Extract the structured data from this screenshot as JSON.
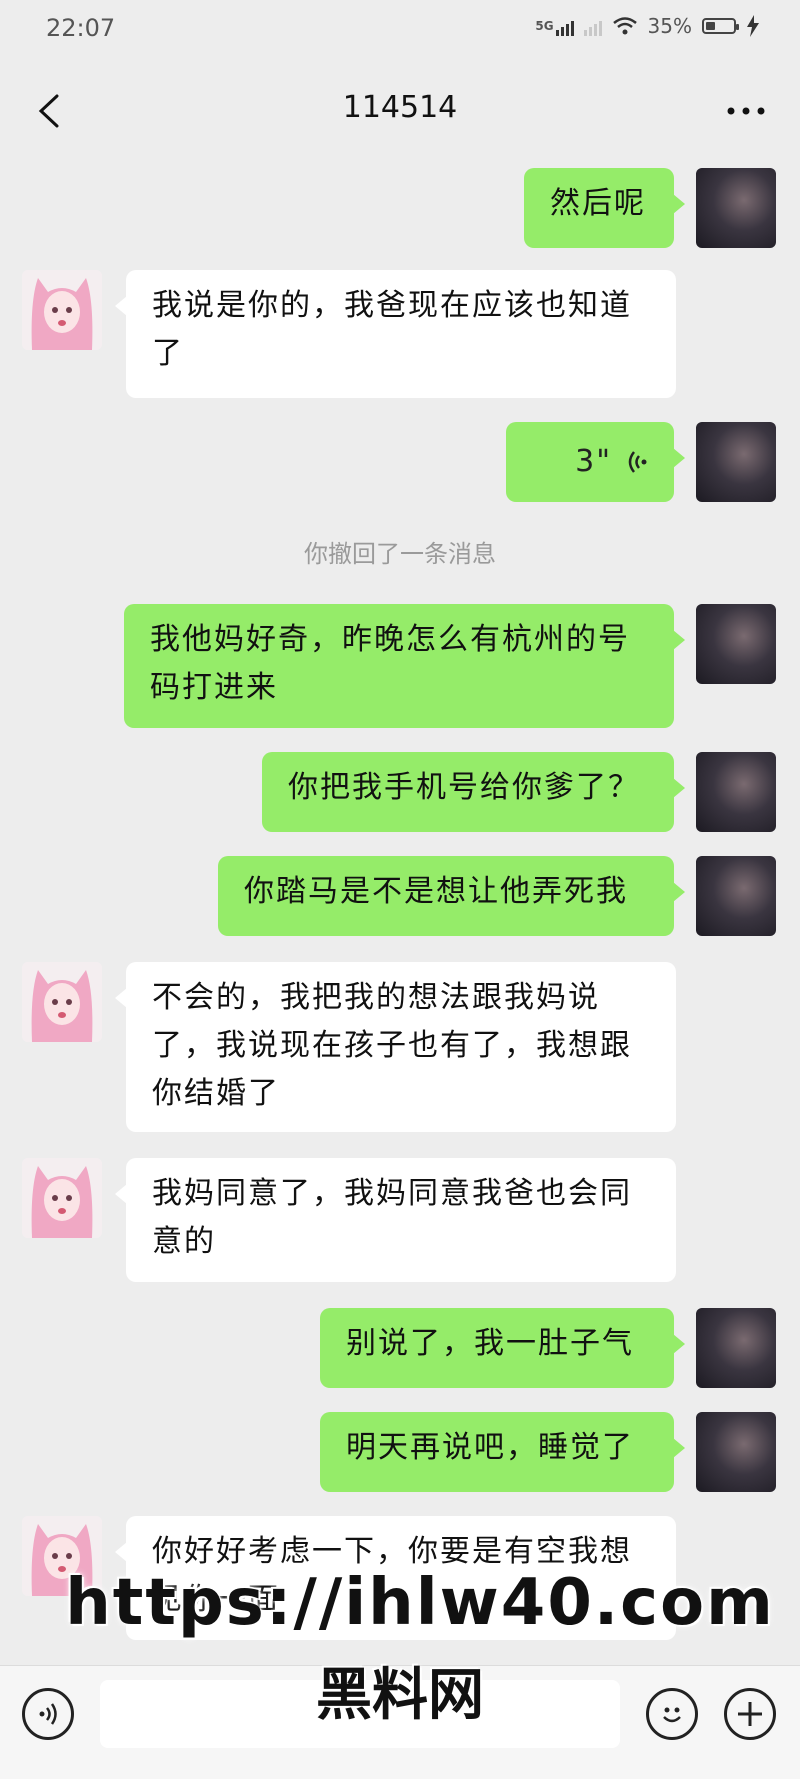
{
  "status": {
    "time": "22:07",
    "network": "5G",
    "battery": "35%",
    "battery_level": 0.35
  },
  "header": {
    "title": "114514"
  },
  "messages": [
    {
      "from": "me",
      "text": "然后呢"
    },
    {
      "from": "them",
      "text": "我说是你的，我爸现在应该也知道了"
    },
    {
      "from": "me",
      "type": "voice",
      "duration": "3\""
    },
    {
      "type": "system",
      "text": "你撤回了一条消息"
    },
    {
      "from": "me",
      "text": "我他妈好奇，昨晚怎么有杭州的号码打进来"
    },
    {
      "from": "me",
      "text": "你把我手机号给你爹了？"
    },
    {
      "from": "me",
      "text": "你踏马是不是想让他弄死我"
    },
    {
      "from": "them",
      "text": "不会的，我把我的想法跟我妈说了，我说现在孩子也有了，我想跟你结婚了"
    },
    {
      "from": "them",
      "text": "我妈同意了，我妈同意我爸也会同意的"
    },
    {
      "from": "me",
      "text": "别说了，我一肚子气"
    },
    {
      "from": "me",
      "text": "明天再说吧，睡觉了"
    },
    {
      "from": "them",
      "text": "你好好考虑一下，你要是有空我想见你一面"
    }
  ],
  "watermark": {
    "line1": "https://ihlw40.com",
    "line2": "黑料网"
  }
}
